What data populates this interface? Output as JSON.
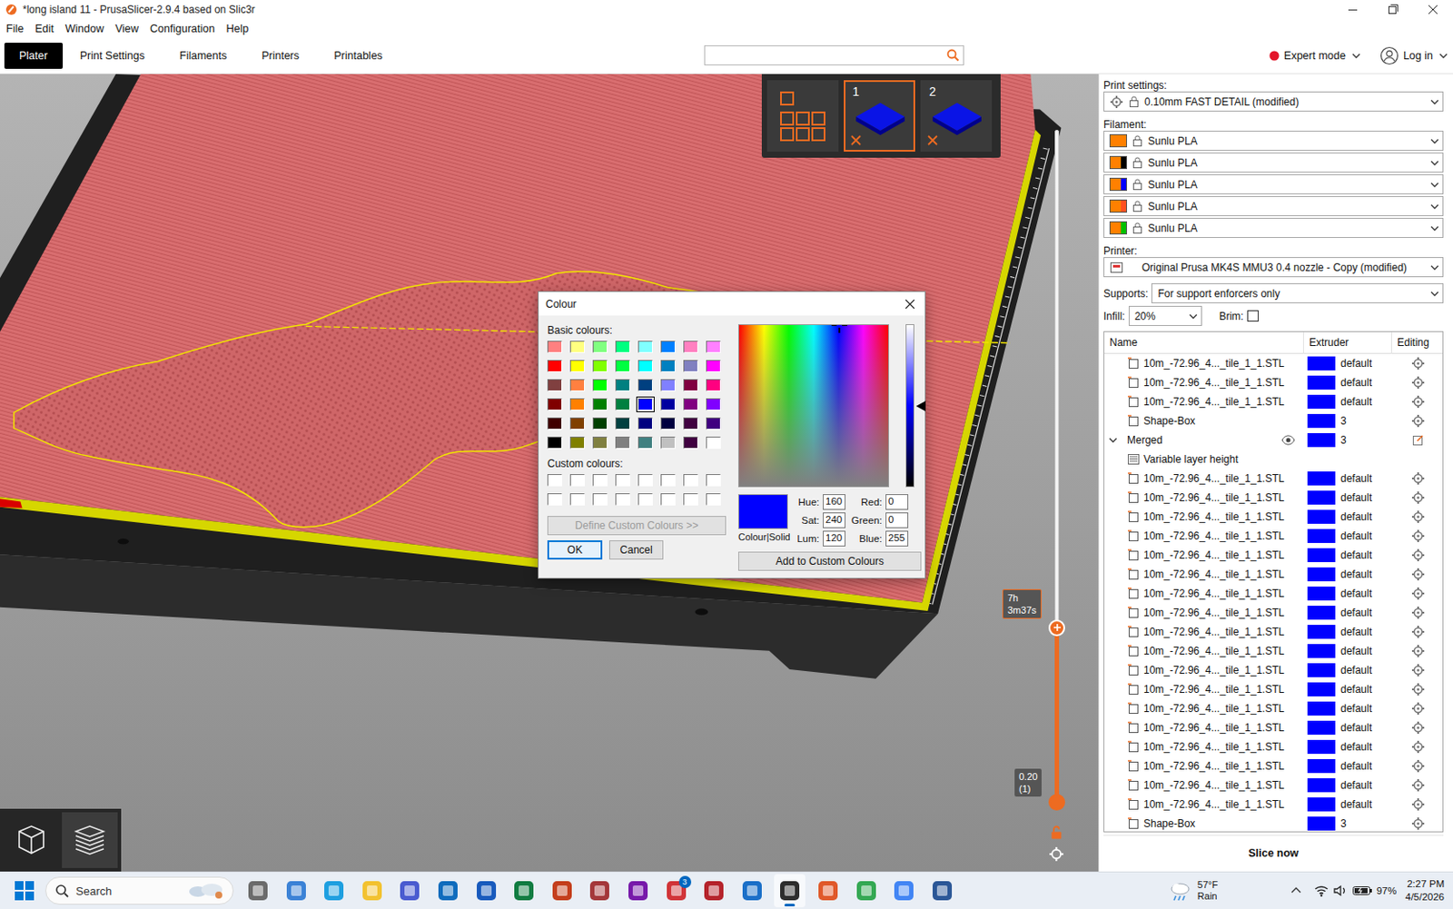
{
  "window": {
    "title": "*long island 11 - PrusaSlicer-2.9.4 based on Slic3r"
  },
  "menu": [
    {
      "label": "File"
    },
    {
      "label": "Edit"
    },
    {
      "label": "Window"
    },
    {
      "label": "View"
    },
    {
      "label": "Configuration"
    },
    {
      "label": "Help"
    }
  ],
  "tabs": [
    {
      "label": "Plater",
      "selected": true
    },
    {
      "label": "Print Settings",
      "selected": false
    },
    {
      "label": "Filaments",
      "selected": false
    },
    {
      "label": "Printers",
      "selected": false
    },
    {
      "label": "Printables",
      "selected": false
    }
  ],
  "mode": {
    "label": "Expert mode"
  },
  "account": {
    "label": "Log in"
  },
  "plates": [
    {
      "kind": "all",
      "selected": false
    },
    {
      "kind": "plate",
      "label": "1",
      "selected": true
    },
    {
      "kind": "plate",
      "label": "2",
      "selected": false
    }
  ],
  "layer_slider": {
    "upper": [
      "7h",
      "3m37s"
    ],
    "lower": [
      "0.20",
      "(1)"
    ],
    "upper_level": 0.26,
    "lower_level": 0.0
  },
  "view_buttons": [
    {
      "kind": "3d",
      "selected": false
    },
    {
      "kind": "preview",
      "selected": true
    }
  ],
  "color_dialog": {
    "title": "Colour",
    "basic_label": "Basic colours:",
    "basic": [
      {
        "color": "#FF8080",
        "selected": false
      },
      {
        "color": "#FFFF80",
        "selected": false
      },
      {
        "color": "#80FF80",
        "selected": false
      },
      {
        "color": "#00FF80",
        "selected": false
      },
      {
        "color": "#80FFFF",
        "selected": false
      },
      {
        "color": "#0080FF",
        "selected": false
      },
      {
        "color": "#FF80C0",
        "selected": false
      },
      {
        "color": "#FF80FF",
        "selected": false
      },
      {
        "color": "#FF0000",
        "selected": false
      },
      {
        "color": "#FFFF00",
        "selected": false
      },
      {
        "color": "#80FF00",
        "selected": false
      },
      {
        "color": "#00FF40",
        "selected": false
      },
      {
        "color": "#00FFFF",
        "selected": false
      },
      {
        "color": "#0080C0",
        "selected": false
      },
      {
        "color": "#8080C0",
        "selected": false
      },
      {
        "color": "#FF00FF",
        "selected": false
      },
      {
        "color": "#804040",
        "selected": false
      },
      {
        "color": "#FF8040",
        "selected": false
      },
      {
        "color": "#00FF00",
        "selected": false
      },
      {
        "color": "#008080",
        "selected": false
      },
      {
        "color": "#004080",
        "selected": false
      },
      {
        "color": "#8080FF",
        "selected": false
      },
      {
        "color": "#800040",
        "selected": false
      },
      {
        "color": "#FF0080",
        "selected": false
      },
      {
        "color": "#800000",
        "selected": false
      },
      {
        "color": "#FF8000",
        "selected": false
      },
      {
        "color": "#008000",
        "selected": false
      },
      {
        "color": "#008040",
        "selected": false
      },
      {
        "color": "#0000FF",
        "selected": true
      },
      {
        "color": "#0000A0",
        "selected": false
      },
      {
        "color": "#800080",
        "selected": false
      },
      {
        "color": "#8000FF",
        "selected": false
      },
      {
        "color": "#400000",
        "selected": false
      },
      {
        "color": "#804000",
        "selected": false
      },
      {
        "color": "#004000",
        "selected": false
      },
      {
        "color": "#004040",
        "selected": false
      },
      {
        "color": "#000080",
        "selected": false
      },
      {
        "color": "#000040",
        "selected": false
      },
      {
        "color": "#400040",
        "selected": false
      },
      {
        "color": "#400080",
        "selected": false
      },
      {
        "color": "#000000",
        "selected": false
      },
      {
        "color": "#808000",
        "selected": false
      },
      {
        "color": "#808040",
        "selected": false
      },
      {
        "color": "#808080",
        "selected": false
      },
      {
        "color": "#408080",
        "selected": false
      },
      {
        "color": "#C0C0C0",
        "selected": false
      },
      {
        "color": "#400040",
        "selected": false
      },
      {
        "color": "#FFFFFF",
        "selected": false
      }
    ],
    "custom_label": "Custom colours:",
    "custom": [
      {
        "empty": true
      },
      {
        "empty": true
      },
      {
        "empty": true
      },
      {
        "empty": true
      },
      {
        "empty": true
      },
      {
        "empty": true
      },
      {
        "empty": true
      },
      {
        "empty": true
      },
      {
        "empty": true
      },
      {
        "empty": true
      },
      {
        "empty": true
      },
      {
        "empty": true
      },
      {
        "empty": true
      },
      {
        "empty": true
      },
      {
        "empty": true
      },
      {
        "empty": true
      }
    ],
    "define": {
      "label": "Define Custom Colours >>",
      "disabled": true
    },
    "ok": {
      "label": "OK",
      "focused": true
    },
    "cancel": {
      "label": "Cancel"
    },
    "hue_level": 0.67,
    "sat_level": 1.0,
    "lum_level": 0.5,
    "preview": {
      "label": "Colour|Solid",
      "color": "#0000FF"
    },
    "fields": [
      {
        "label": "Hue:",
        "value": "160"
      },
      {
        "label": "Red:",
        "value": "0"
      },
      {
        "label": "Sat:",
        "value": "240"
      },
      {
        "label": "Green:",
        "value": "0"
      },
      {
        "label": "Lum:",
        "value": "120"
      },
      {
        "label": "Blue:",
        "value": "255"
      }
    ],
    "add": {
      "label": "Add to Custom Colours"
    }
  },
  "sidebar": {
    "print_settings": {
      "label": "Print settings:",
      "value": "0.10mm FAST DETAIL (modified)"
    },
    "filament": {
      "label": "Filament:",
      "items": [
        {
          "name": "Sunlu PLA",
          "color": "#FF8000",
          "extruder_color": "#FF8000"
        },
        {
          "name": "Sunlu PLA",
          "color": "#FF8000",
          "extruder_color": "#000000"
        },
        {
          "name": "Sunlu PLA",
          "color": "#FF8000",
          "extruder_color": "#0000FF"
        },
        {
          "name": "Sunlu PLA",
          "color": "#FF8000",
          "extruder_color": "#FF5020"
        },
        {
          "name": "Sunlu PLA",
          "color": "#FF8000",
          "extruder_color": "#00C000"
        }
      ]
    },
    "printer": {
      "label": "Printer:",
      "value": "Original Prusa MK4S MMU3 0.4 nozzle - Copy (modified)"
    },
    "supports": {
      "label": "Supports:",
      "value": "For support enforcers only"
    },
    "infill": {
      "label": "Infill:",
      "value": "20%"
    },
    "brim": {
      "label": "Brim:",
      "checked": false
    },
    "object_list": {
      "columns": [
        "Name",
        "Extruder",
        "Editing"
      ],
      "rows": [
        {
          "kind": "part",
          "name": "10m_-72.96_4..._tile_1_1.STL",
          "extruder": "default",
          "color": "#0000FF"
        },
        {
          "kind": "part",
          "name": "10m_-72.96_4..._tile_1_1.STL",
          "extruder": "default",
          "color": "#0000FF"
        },
        {
          "kind": "part",
          "name": "10m_-72.96_4..._tile_1_1.STL",
          "extruder": "default",
          "color": "#0000FF"
        },
        {
          "kind": "part",
          "name": "Shape-Box",
          "extruder": "3",
          "color": "#0000FF"
        },
        {
          "kind": "group",
          "name": "Merged",
          "extruder": "3",
          "color": "#0000FF",
          "expanded": true,
          "visible": true
        },
        {
          "kind": "setting",
          "name": "Variable layer height"
        },
        {
          "kind": "part",
          "name": "10m_-72.96_4..._tile_1_1.STL",
          "extruder": "default",
          "color": "#0000FF"
        },
        {
          "kind": "part",
          "name": "10m_-72.96_4..._tile_1_1.STL",
          "extruder": "default",
          "color": "#0000FF"
        },
        {
          "kind": "part",
          "name": "10m_-72.96_4..._tile_1_1.STL",
          "extruder": "default",
          "color": "#0000FF"
        },
        {
          "kind": "part",
          "name": "10m_-72.96_4..._tile_1_1.STL",
          "extruder": "default",
          "color": "#0000FF"
        },
        {
          "kind": "part",
          "name": "10m_-72.96_4..._tile_1_1.STL",
          "extruder": "default",
          "color": "#0000FF"
        },
        {
          "kind": "part",
          "name": "10m_-72.96_4..._tile_1_1.STL",
          "extruder": "default",
          "color": "#0000FF"
        },
        {
          "kind": "part",
          "name": "10m_-72.96_4..._tile_1_1.STL",
          "extruder": "default",
          "color": "#0000FF"
        },
        {
          "kind": "part",
          "name": "10m_-72.96_4..._tile_1_1.STL",
          "extruder": "default",
          "color": "#0000FF"
        },
        {
          "kind": "part",
          "name": "10m_-72.96_4..._tile_1_1.STL",
          "extruder": "default",
          "color": "#0000FF"
        },
        {
          "kind": "part",
          "name": "10m_-72.96_4..._tile_1_1.STL",
          "extruder": "default",
          "color": "#0000FF"
        },
        {
          "kind": "part",
          "name": "10m_-72.96_4..._tile_1_1.STL",
          "extruder": "default",
          "color": "#0000FF"
        },
        {
          "kind": "part",
          "name": "10m_-72.96_4..._tile_1_1.STL",
          "extruder": "default",
          "color": "#0000FF"
        },
        {
          "kind": "part",
          "name": "10m_-72.96_4..._tile_1_1.STL",
          "extruder": "default",
          "color": "#0000FF"
        },
        {
          "kind": "part",
          "name": "10m_-72.96_4..._tile_1_1.STL",
          "extruder": "default",
          "color": "#0000FF"
        },
        {
          "kind": "part",
          "name": "10m_-72.96_4..._tile_1_1.STL",
          "extruder": "default",
          "color": "#0000FF"
        },
        {
          "kind": "part",
          "name": "10m_-72.96_4..._tile_1_1.STL",
          "extruder": "default",
          "color": "#0000FF"
        },
        {
          "kind": "part",
          "name": "10m_-72.96_4..._tile_1_1.STL",
          "extruder": "default",
          "color": "#0000FF"
        },
        {
          "kind": "part",
          "name": "10m_-72.96_4..._tile_1_1.STL",
          "extruder": "default",
          "color": "#0000FF"
        },
        {
          "kind": "part",
          "name": "Shape-Box",
          "extruder": "3",
          "color": "#0000FF"
        }
      ]
    },
    "slice_button": {
      "label": "Slice now"
    }
  },
  "taskbar": {
    "search": "Search",
    "apps": [
      {
        "selected": false
      },
      {
        "selected": false
      },
      {
        "selected": false
      },
      {
        "selected": false
      },
      {
        "selected": false
      },
      {
        "selected": false
      },
      {
        "selected": false
      },
      {
        "selected": false
      },
      {
        "selected": false
      },
      {
        "selected": false
      },
      {
        "selected": false
      },
      {
        "selected": false,
        "badge": "3"
      },
      {
        "selected": false
      },
      {
        "selected": false
      },
      {
        "selected": true
      },
      {
        "selected": false
      },
      {
        "selected": false
      },
      {
        "selected": false
      },
      {
        "selected": false
      }
    ],
    "weather": {
      "temp": "57°F",
      "desc": "Rain"
    },
    "battery": "97%",
    "time": "2:27 PM",
    "date": "4/5/2026"
  }
}
